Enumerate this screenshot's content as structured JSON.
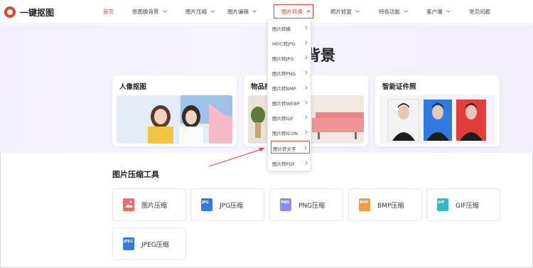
{
  "header": {
    "logo_text": "一键抠图",
    "nav": [
      {
        "label": "首页",
        "active": true
      },
      {
        "label": "抠图换背景"
      },
      {
        "label": "图片压缩"
      },
      {
        "label": "图片编辑"
      },
      {
        "label": "图片转换",
        "open": true
      },
      {
        "label": "照片修复"
      },
      {
        "label": "特色功能"
      },
      {
        "label": "客户端"
      },
      {
        "label": "常见问题"
      }
    ]
  },
  "hero": {
    "title_fragment": "背景",
    "cards": [
      {
        "title": "人像抠图"
      },
      {
        "title": "物品抠"
      },
      {
        "title": "智能证件照"
      }
    ]
  },
  "dropdown": {
    "items": [
      {
        "label": "图片转换"
      },
      {
        "label": "HEIC转JPG"
      },
      {
        "label": "图片转JPG"
      },
      {
        "label": "图片转PNG"
      },
      {
        "label": "图片转BMP"
      },
      {
        "label": "图片转WEBP"
      },
      {
        "label": "图片转GIF"
      },
      {
        "label": "图片转ICON"
      },
      {
        "label": "图片转文字",
        "highlighted": true
      },
      {
        "label": "图片转PDF"
      }
    ]
  },
  "compress_section": {
    "title": "图片压缩工具",
    "tools": [
      {
        "label": "图片压缩",
        "icon": "image-icon",
        "icon_text": "",
        "color": "#f06a6a"
      },
      {
        "label": "JPG压缩",
        "icon": "jpg-file-icon",
        "icon_text": "JPG",
        "color": "#2f7be8"
      },
      {
        "label": "PNG压缩",
        "icon": "png-file-icon",
        "icon_text": "PNG",
        "color": "#8f8cf0"
      },
      {
        "label": "BMP压缩",
        "icon": "bmp-file-icon",
        "icon_text": "BMP",
        "color": "#f59a3c"
      },
      {
        "label": "GIF压缩",
        "icon": "gif-file-icon",
        "icon_text": "GIF",
        "color": "#35b8c9"
      },
      {
        "label": "JPEG压缩",
        "icon": "jpeg-file-icon",
        "icon_text": "JPEG",
        "color": "#2f7be8"
      }
    ]
  },
  "colors": {
    "accent": "#e8432f"
  }
}
